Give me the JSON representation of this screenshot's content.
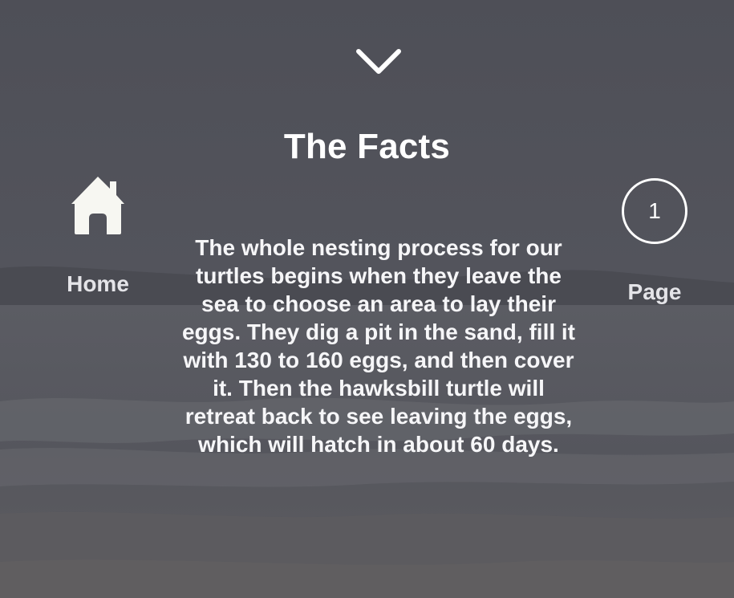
{
  "colors": {
    "overlay": "#55565e",
    "text": "#ffffff",
    "icon": "#f7f7f2"
  },
  "header": {
    "scroll_icon": "chevron-down-icon"
  },
  "main": {
    "title": "The Facts",
    "body": "The whole nesting process for our turtles begins when they leave the sea to choose an area to lay their eggs. They dig a pit in the sand, fill it with 130 to 160 eggs, and then cover it. Then the hawksbill turtle will retreat back to see leaving the eggs, which will hatch in about 60 days."
  },
  "nav": {
    "home": {
      "icon": "home-icon",
      "label": "Home"
    },
    "page": {
      "number": "1",
      "label": "Page"
    }
  }
}
